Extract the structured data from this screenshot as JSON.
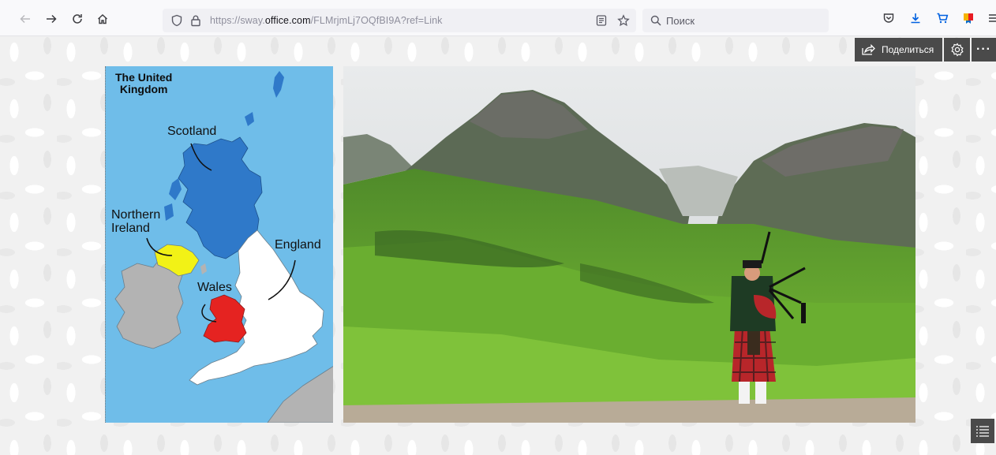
{
  "browser": {
    "url_prefix": "https://sway.",
    "url_domain": "office.com",
    "url_path": "/FLMrjmLj7OQfBI9A?ref=Link",
    "search_placeholder": "Поиск"
  },
  "sway": {
    "share_label": "Поделиться",
    "more_label": "···"
  },
  "map": {
    "title_line1": "The United",
    "title_line2": "Kingdom",
    "labels": {
      "scotland": "Scotland",
      "northern_ireland_line1": "Northern",
      "northern_ireland_line2": "Ireland",
      "england": "England",
      "wales": "Wales"
    },
    "colors": {
      "sea": "#6fbde9",
      "scotland": "#2f79c9",
      "northern_ireland": "#f2f216",
      "wales": "#e52321",
      "england": "#ffffff",
      "ireland": "#b3b3b3"
    }
  },
  "photo": {
    "subject": "Bagpiper in Scottish highlands"
  }
}
